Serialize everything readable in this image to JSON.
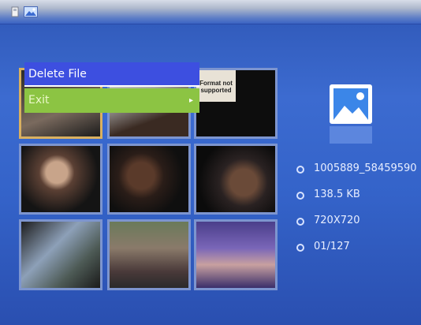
{
  "topbar": {
    "icons": [
      "sd-card-icon",
      "image-icon"
    ]
  },
  "menu": {
    "items": [
      {
        "label": "Delete File"
      },
      {
        "label": "Exit",
        "submenu_arrow": "▸"
      }
    ]
  },
  "thumbnails": {
    "unsupported_text": "Format not supported"
  },
  "info": {
    "filename": "1005889_58459590",
    "filesize": "138.5  KB",
    "resolution": "720X720",
    "position": "01/127"
  },
  "colors": {
    "background": "#3463c9",
    "menu_selected": "#3d4fe0",
    "menu_item": "#8cc443",
    "tile_border": "#7d95cf",
    "tile_selected_border": "#d9b060"
  }
}
